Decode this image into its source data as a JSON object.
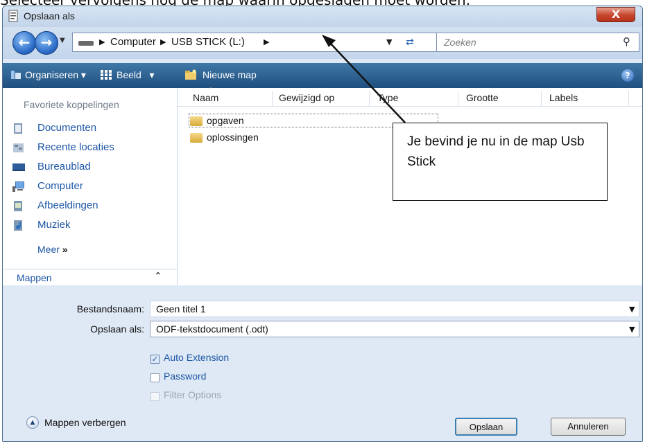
{
  "caption": "Selecteer vervolgens nog de map waarin opgeslagen moet worden.",
  "window": {
    "title": "Opslaan als",
    "close_label": "X"
  },
  "address": {
    "crumbs": [
      "Computer",
      "USB STICK (L:)"
    ],
    "search_placeholder": "Zoeken"
  },
  "toolbar": {
    "organize": "Organiseren",
    "view": "Beeld",
    "new_folder": "Nieuwe map",
    "help": "?"
  },
  "sidebar": {
    "header": "Favoriete koppelingen",
    "items": [
      {
        "label": "Documenten",
        "icon": "documents-icon"
      },
      {
        "label": "Recente locaties",
        "icon": "recent-places-icon"
      },
      {
        "label": "Bureaublad",
        "icon": "desktop-icon"
      },
      {
        "label": "Computer",
        "icon": "computer-icon"
      },
      {
        "label": "Afbeeldingen",
        "icon": "pictures-icon"
      },
      {
        "label": "Muziek",
        "icon": "music-icon"
      }
    ],
    "more": "Meer",
    "folders_label": "Mappen"
  },
  "filelist": {
    "columns": [
      "Naam",
      "Gewijzigd op",
      "Type",
      "Grootte",
      "Labels"
    ],
    "files": [
      "opgaven",
      "oplossingen"
    ]
  },
  "form": {
    "filename_label": "Bestandsnaam:",
    "filename_value": "Geen titel 1",
    "savetype_label": "Opslaan als:",
    "savetype_value": "ODF-tekstdocument (.odt)",
    "options": [
      {
        "label": "Auto Extension",
        "checked": true,
        "enabled": true
      },
      {
        "label": "Password",
        "checked": false,
        "enabled": true
      },
      {
        "label": "Filter Options",
        "checked": false,
        "enabled": false
      }
    ],
    "hide_folders": "Mappen verbergen",
    "save": "Opslaan",
    "cancel": "Annuleren"
  },
  "callout": {
    "text": "Je bevind je nu in de map Usb Stick"
  },
  "colors": {
    "toolbar": "#2d5f8f",
    "link": "#1d57a6",
    "frame": "#dfe9f5"
  }
}
